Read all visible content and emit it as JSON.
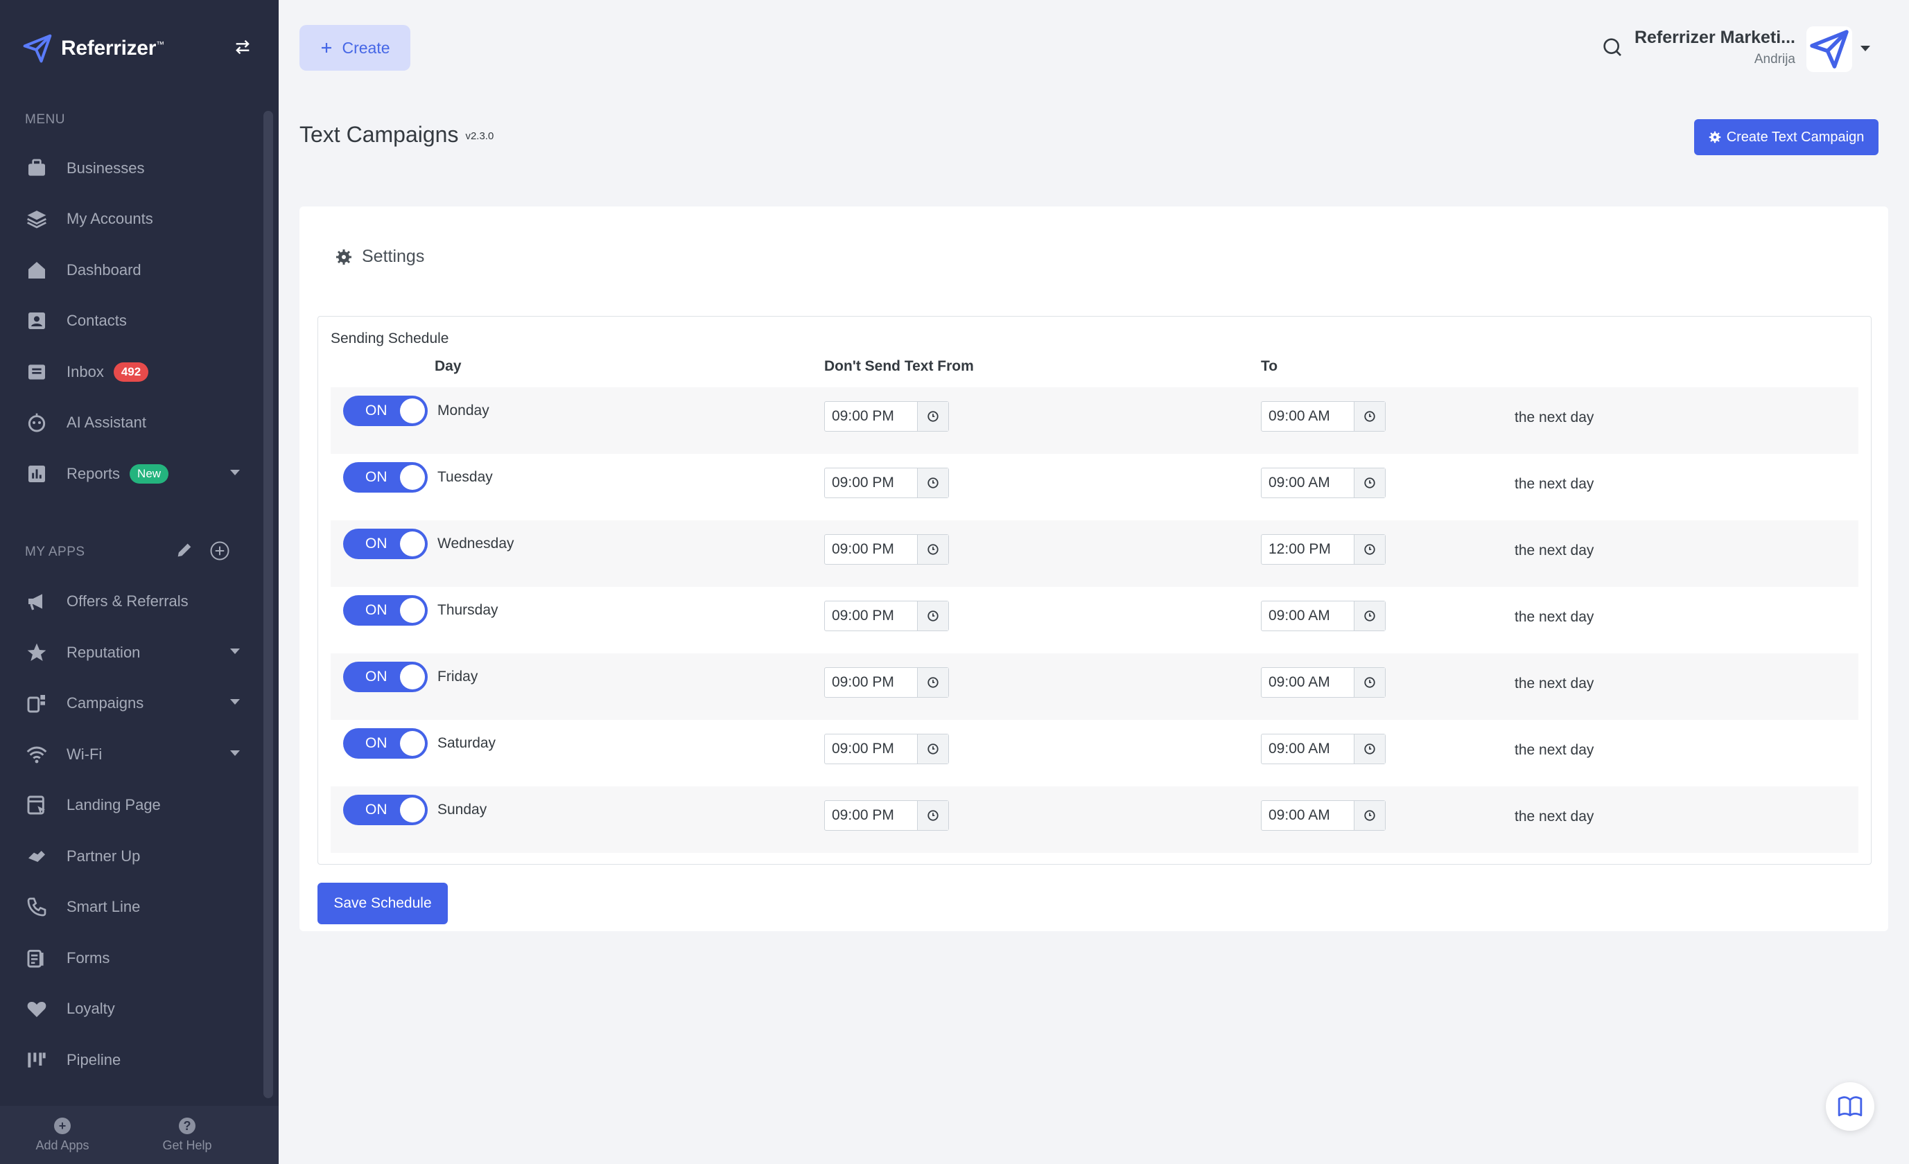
{
  "brand": {
    "name": "Referrizer",
    "tm": "™"
  },
  "sidebar": {
    "menu_title": "MENU",
    "items": [
      {
        "label": "Businesses",
        "icon": "briefcase-icon"
      },
      {
        "label": "My Accounts",
        "icon": "layers-icon"
      },
      {
        "label": "Dashboard",
        "icon": "home-icon"
      },
      {
        "label": "Contacts",
        "icon": "contact-card-icon"
      },
      {
        "label": "Inbox",
        "icon": "inbox-icon",
        "badge": "492"
      },
      {
        "label": "AI Assistant",
        "icon": "robot-icon"
      },
      {
        "label": "Reports",
        "icon": "bar-chart-icon",
        "badge": "New"
      }
    ],
    "apps_title": "MY APPS",
    "apps": [
      {
        "label": "Offers & Referrals",
        "icon": "megaphone-icon"
      },
      {
        "label": "Reputation",
        "icon": "star-icon"
      },
      {
        "label": "Campaigns",
        "icon": "campaigns-icon"
      },
      {
        "label": "Wi-Fi",
        "icon": "wifi-icon"
      },
      {
        "label": "Landing Page",
        "icon": "landing-page-icon"
      },
      {
        "label": "Partner Up",
        "icon": "handshake-icon"
      },
      {
        "label": "Smart Line",
        "icon": "phone-icon"
      },
      {
        "label": "Forms",
        "icon": "forms-icon"
      },
      {
        "label": "Loyalty",
        "icon": "heart-icon"
      },
      {
        "label": "Pipeline",
        "icon": "pipeline-icon"
      }
    ],
    "footer": {
      "add_apps": "Add Apps",
      "get_help": "Get Help"
    }
  },
  "topbar": {
    "create_label": "Create",
    "org_name": "Referrizer Marketi...",
    "user_name": "Andrija"
  },
  "page": {
    "title": "Text Campaigns",
    "version": "v2.3.0",
    "create_campaign_label": "Create Text Campaign"
  },
  "settings": {
    "title": "Settings",
    "schedule_title": "Sending Schedule",
    "columns": {
      "day": "Day",
      "from": "Don't Send Text From",
      "to": "To"
    },
    "rows": [
      {
        "toggle": "ON",
        "day": "Monday",
        "from": "09:00 PM",
        "to": "09:00 AM",
        "suffix": "the next day"
      },
      {
        "toggle": "ON",
        "day": "Tuesday",
        "from": "09:00 PM",
        "to": "09:00 AM",
        "suffix": "the next day"
      },
      {
        "toggle": "ON",
        "day": "Wednesday",
        "from": "09:00 PM",
        "to": "12:00 PM",
        "suffix": "the next day"
      },
      {
        "toggle": "ON",
        "day": "Thursday",
        "from": "09:00 PM",
        "to": "09:00 AM",
        "suffix": "the next day"
      },
      {
        "toggle": "ON",
        "day": "Friday",
        "from": "09:00 PM",
        "to": "09:00 AM",
        "suffix": "the next day"
      },
      {
        "toggle": "ON",
        "day": "Saturday",
        "from": "09:00 PM",
        "to": "09:00 AM",
        "suffix": "the next day"
      },
      {
        "toggle": "ON",
        "day": "Sunday",
        "from": "09:00 PM",
        "to": "09:00 AM",
        "suffix": "the next day"
      }
    ],
    "save_label": "Save Schedule"
  },
  "colors": {
    "primary": "#4362e8",
    "sidebar_bg": "#272c40",
    "badge_red": "#e74b4b",
    "badge_green": "#24b47e"
  }
}
